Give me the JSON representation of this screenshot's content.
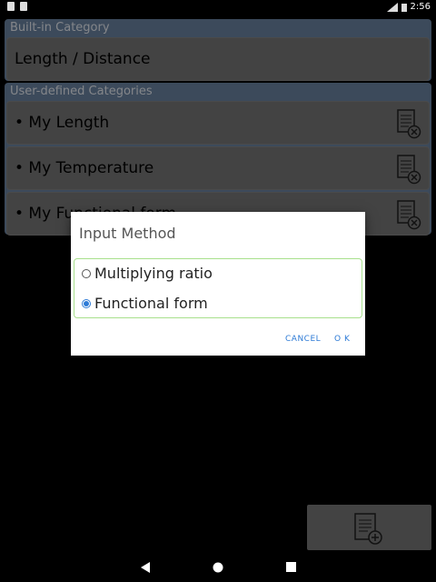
{
  "status_bar": {
    "time": "2:56"
  },
  "builtin": {
    "header": "Built-in Category",
    "item": "Length / Distance"
  },
  "userdefined": {
    "header": "User-defined Categories",
    "items": [
      {
        "label": "• My Length"
      },
      {
        "label": "• My Temperature"
      },
      {
        "label": "• My Functional form"
      }
    ]
  },
  "dialog": {
    "title": "Input Method",
    "options": [
      {
        "label": "Multiplying ratio",
        "checked": false
      },
      {
        "label": "Functional form",
        "checked": true
      }
    ],
    "cancel": "CANCEL",
    "ok": "O K"
  },
  "colors": {
    "accent": "#2e7bd6",
    "panel": "#6d87a7",
    "row": "#7a7a7a"
  }
}
